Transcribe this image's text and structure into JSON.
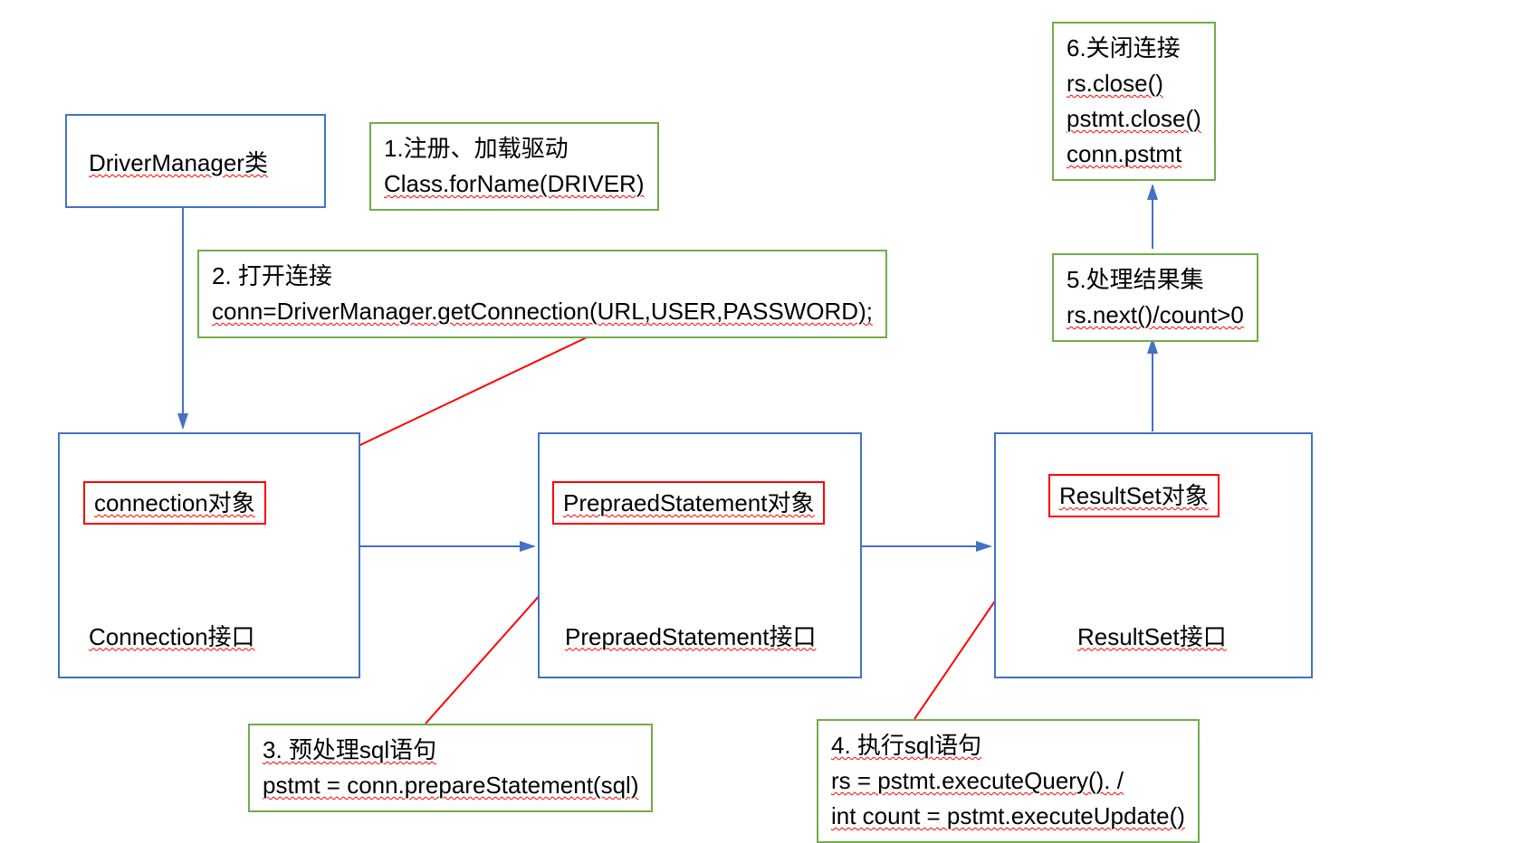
{
  "nodes": {
    "driverManager": "DriverManager类",
    "connectionObj": "connection对象",
    "connectionIf": "Connection接口",
    "prepStmtObj": "PrepraedStatement对象",
    "prepStmtIf": "PrepraedStatement接口",
    "resultSetObj": "ResultSet对象",
    "resultSetIf": "ResultSet接口"
  },
  "steps": {
    "s1_line1": "1.注册、加载驱动",
    "s1_line2": "Class.forName(DRIVER)",
    "s2_line1": "2. 打开连接",
    "s2_line2": "conn=DriverManager.getConnection(URL,USER,PASSWORD);",
    "s3_line1": "3. 预处理sql语句",
    "s3_line2": "pstmt = conn.prepareStatement(sql)",
    "s4_line1": "4. 执行sql语句",
    "s4_line2": "rs = pstmt.executeQuery().    /",
    "s4_line3": "int count = pstmt.executeUpdate()",
    "s5_line1": "5.处理结果集",
    "s5_line2": "rs.next()/count>0",
    "s6_line1": "6.关闭连接",
    "s6_line2": "rs.close()",
    "s6_line3": "pstmt.close()",
    "s6_line4": "conn.pstmt"
  }
}
